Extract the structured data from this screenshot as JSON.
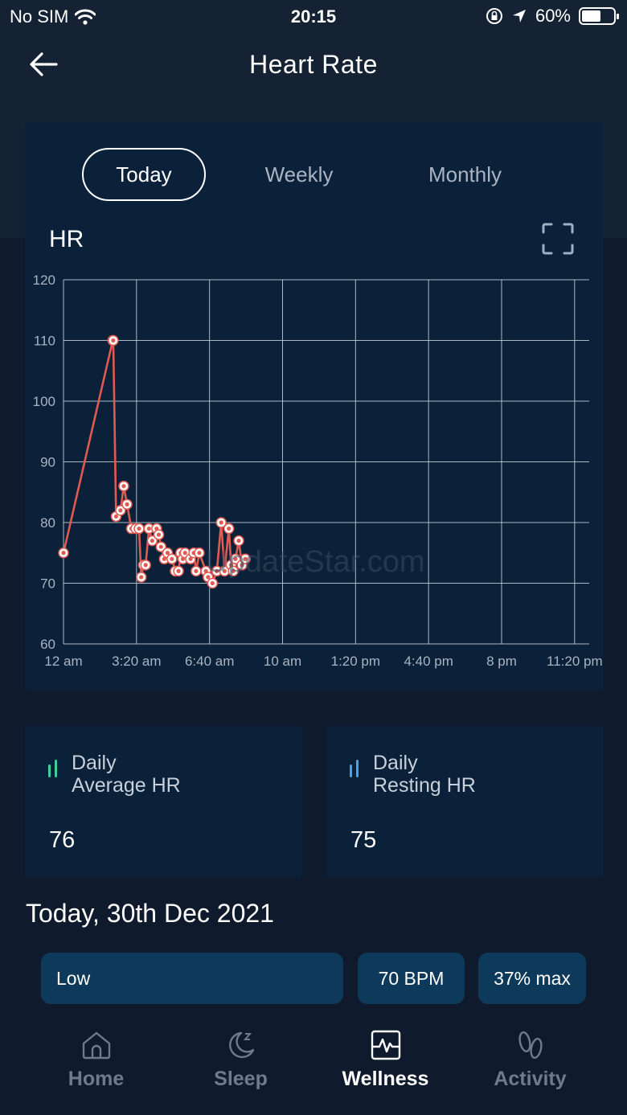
{
  "status_bar": {
    "carrier": "No SIM",
    "time": "20:15",
    "battery_text": "60%",
    "battery_level": 0.6
  },
  "header": {
    "title": "Heart Rate"
  },
  "tabs": [
    {
      "label": "Today",
      "active": true
    },
    {
      "label": "Weekly",
      "active": false
    },
    {
      "label": "Monthly",
      "active": false
    }
  ],
  "chart": {
    "title": "HR",
    "watermark": "UpdateStar.com"
  },
  "chart_data": {
    "type": "line",
    "title": "HR",
    "ylim": [
      60,
      120
    ],
    "xlim_hours": [
      0,
      24
    ],
    "y_ticks": [
      "120",
      "110",
      "100",
      "90",
      "80",
      "70",
      "60"
    ],
    "x_ticks": [
      "12 am",
      "3:20 am",
      "6:40 am",
      "10 am",
      "1:20 pm",
      "4:40 pm",
      "8 pm",
      "11:20 pm"
    ],
    "grid": true,
    "line_color": "#e05a52",
    "series": [
      {
        "x_hours": [
          0,
          2.25,
          2.27,
          2.4,
          2.6,
          2.75,
          2.9,
          3.1,
          3.3,
          3.45,
          3.55,
          3.65,
          3.75,
          3.9,
          4.05,
          4.25,
          4.35,
          4.45,
          4.6,
          4.75,
          4.95,
          5.1,
          5.25,
          5.35,
          5.45,
          5.55,
          5.8,
          5.95,
          6.05,
          6.2,
          6.5,
          6.6,
          6.8,
          7.0,
          7.2,
          7.35,
          7.55,
          7.65,
          7.75,
          7.85,
          8.0,
          8.15,
          8.3
        ],
        "y": [
          75,
          110,
          110,
          81,
          82,
          86,
          83,
          79,
          79,
          79,
          71,
          73,
          73,
          79,
          77,
          79,
          78,
          76,
          74,
          75,
          74,
          72,
          72,
          75,
          74,
          75,
          74,
          75,
          72,
          75,
          72,
          71,
          70,
          72,
          80,
          72,
          79,
          73,
          72,
          74,
          77,
          73,
          74
        ]
      }
    ]
  },
  "stats": {
    "average": {
      "label_line1": "Daily",
      "label_line2": "Average HR",
      "value": "76",
      "color": "#3ecf9b"
    },
    "resting": {
      "label_line1": "Daily",
      "label_line2": "Resting HR",
      "value": "75",
      "color": "#4aa3e6"
    }
  },
  "date_heading": "Today, 30th Dec 2021",
  "pills": {
    "zone": "Low",
    "bpm": "70 BPM",
    "max": "37% max"
  },
  "bottom_nav": [
    {
      "label": "Home",
      "icon": "home-icon",
      "active": false
    },
    {
      "label": "Sleep",
      "icon": "sleep-icon",
      "active": false
    },
    {
      "label": "Wellness",
      "icon": "wellness-icon",
      "active": true
    },
    {
      "label": "Activity",
      "icon": "activity-icon",
      "active": false
    }
  ]
}
